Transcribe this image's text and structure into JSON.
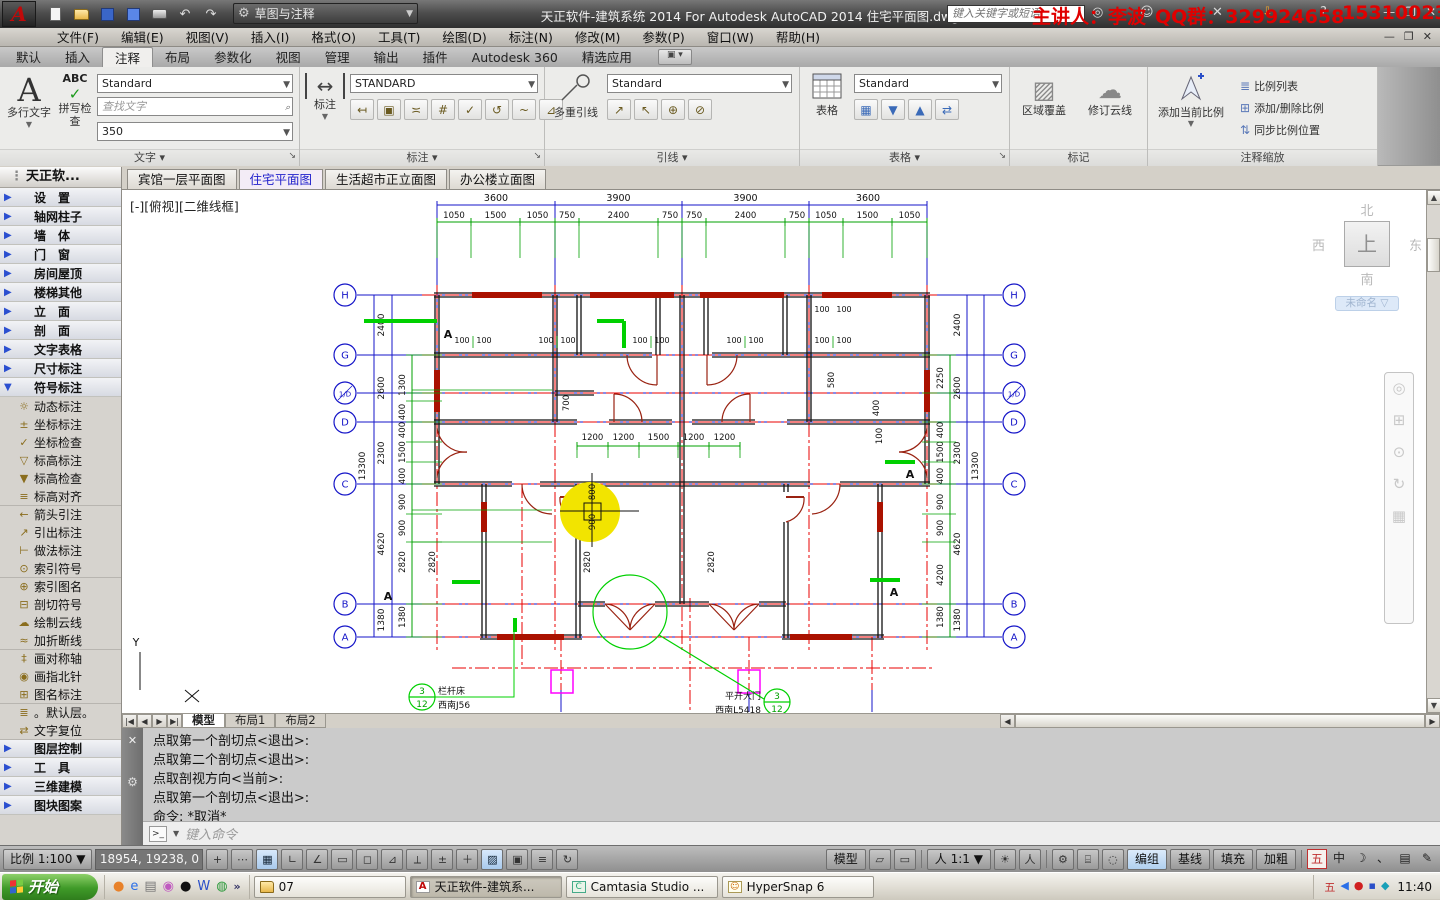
{
  "title_bar": {
    "app_title": "天正软件-建筑系统 2014  For Autodesk AutoCAD 2014   住宅平面图.dwg",
    "workspace": "草图与注释",
    "search_placeholder": "键入关键字或短语",
    "watermark": {
      "presenter": "主讲人：李波",
      "qq_group": "QQ群：329924658",
      "qq_extra": "15310023"
    }
  },
  "menu_bar": {
    "items": [
      {
        "label": "文件(F)"
      },
      {
        "label": "编辑(E)"
      },
      {
        "label": "视图(V)"
      },
      {
        "label": "插入(I)"
      },
      {
        "label": "格式(O)"
      },
      {
        "label": "工具(T)"
      },
      {
        "label": "绘图(D)"
      },
      {
        "label": "标注(N)"
      },
      {
        "label": "修改(M)"
      },
      {
        "label": "参数(P)"
      },
      {
        "label": "窗口(W)"
      },
      {
        "label": "帮助(H)"
      }
    ]
  },
  "ribbon": {
    "tabs": [
      {
        "label": "默认"
      },
      {
        "label": "插入"
      },
      {
        "label": "注释",
        "cls": "active"
      },
      {
        "label": "布局"
      },
      {
        "label": "参数化"
      },
      {
        "label": "视图"
      },
      {
        "label": "管理"
      },
      {
        "label": "输出"
      },
      {
        "label": "插件"
      },
      {
        "label": "Autodesk 360"
      },
      {
        "label": "精选应用"
      }
    ],
    "text_panel": {
      "mtext": "多行文字",
      "spell": "拼写检查",
      "spell_abc": "ABC",
      "style": "Standard",
      "find_placeholder": "查找文字",
      "text_height": "350",
      "footer": "文字"
    },
    "dim_panel": {
      "big": "标注",
      "style": "STANDARD",
      "footer": "标注",
      "icons": [
        {
          "g": "↤"
        },
        {
          "g": "▣"
        },
        {
          "g": "≍"
        },
        {
          "g": "#"
        },
        {
          "g": "✓"
        },
        {
          "g": "↺"
        },
        {
          "g": "~"
        },
        {
          "g": "⊿"
        }
      ]
    },
    "leader_panel": {
      "big": "多重引线",
      "style": "Standard",
      "footer": "引线",
      "icons": [
        {
          "g": "↗"
        },
        {
          "g": "↖"
        },
        {
          "g": "⊕"
        },
        {
          "g": "⊘"
        }
      ]
    },
    "table_panel": {
      "big": "表格",
      "style": "Standard",
      "footer": "表格",
      "icons": [
        {
          "g": "▦"
        },
        {
          "g": "▼"
        },
        {
          "g": "▲"
        },
        {
          "g": "⇄"
        }
      ]
    },
    "mark_panel": {
      "footer": "标记",
      "items": [
        {
          "label": "区域覆盖",
          "g": "▨"
        },
        {
          "label": "修订云线",
          "g": "☁"
        }
      ]
    },
    "scale_panel": {
      "big": "添加当前比例",
      "footer": "注释缩放",
      "items": [
        {
          "label": "比例列表",
          "g": "≣"
        },
        {
          "label": "添加/删除比例",
          "g": "⊞"
        },
        {
          "label": "同步比例位置",
          "g": "⇅"
        }
      ]
    }
  },
  "sidebar": {
    "title": "天正软...",
    "items": [
      {
        "cls": "group",
        "arrow": "▶",
        "label": "设　置"
      },
      {
        "cls": "group",
        "arrow": "▶",
        "label": "轴网柱子"
      },
      {
        "cls": "group",
        "arrow": "▶",
        "label": "墙　体"
      },
      {
        "cls": "group",
        "arrow": "▶",
        "label": "门　窗"
      },
      {
        "cls": "group",
        "arrow": "▶",
        "label": "房间屋顶"
      },
      {
        "cls": "group",
        "arrow": "▶",
        "label": "楼梯其他"
      },
      {
        "cls": "group",
        "arrow": "▶",
        "label": "立　面"
      },
      {
        "cls": "group",
        "arrow": "▶",
        "label": "剖　面"
      },
      {
        "cls": "group",
        "arrow": "▶",
        "label": "文字表格"
      },
      {
        "cls": "group",
        "arrow": "▶",
        "label": "尺寸标注"
      },
      {
        "cls": "group",
        "arrow": "▼",
        "label": "符号标注"
      },
      {
        "cls": "cmd",
        "icon": "☼",
        "label": "动态标注"
      },
      {
        "cls": "cmd",
        "icon": "±",
        "label": "坐标标注"
      },
      {
        "cls": "cmd",
        "icon": "✓",
        "label": "坐标检查"
      },
      {
        "cls": "cmd",
        "icon": "▽",
        "label": "标高标注"
      },
      {
        "cls": "cmd",
        "icon": "▼",
        "label": "标高检查"
      },
      {
        "cls": "cmd",
        "icon": "≡",
        "label": "标高对齐"
      },
      {
        "cls": "cmd sep",
        "icon": "←",
        "label": "箭头引注"
      },
      {
        "cls": "cmd",
        "icon": "↗",
        "label": "引出标注"
      },
      {
        "cls": "cmd",
        "icon": "⊢",
        "label": "做法标注"
      },
      {
        "cls": "cmd",
        "icon": "⊙",
        "label": "索引符号"
      },
      {
        "cls": "cmd sep",
        "icon": "⊕",
        "label": "索引图名"
      },
      {
        "cls": "cmd",
        "icon": "⊟",
        "label": "剖切符号"
      },
      {
        "cls": "cmd",
        "icon": "☁",
        "label": "绘制云线"
      },
      {
        "cls": "cmd",
        "icon": "≈",
        "label": "加折断线"
      },
      {
        "cls": "cmd sep",
        "icon": "‡",
        "label": "画对称轴"
      },
      {
        "cls": "cmd",
        "icon": "◉",
        "label": "画指北针"
      },
      {
        "cls": "cmd",
        "icon": "⊞",
        "label": "图名标注"
      },
      {
        "cls": "cmd sep",
        "icon": "≣",
        "label": "。默认层。"
      },
      {
        "cls": "cmd",
        "icon": "⇄",
        "label": "文字复位"
      },
      {
        "cls": "group sep",
        "arrow": "▶",
        "label": "图层控制"
      },
      {
        "cls": "group",
        "arrow": "▶",
        "label": "工　具"
      },
      {
        "cls": "group",
        "arrow": "▶",
        "label": "三维建模"
      },
      {
        "cls": "group",
        "arrow": "▶",
        "label": "图块图案"
      }
    ]
  },
  "doc_tabs": [
    {
      "label": "宾馆一层平面图"
    },
    {
      "label": "住宅平面图",
      "cls": "active"
    },
    {
      "label": "生活超市正立面图"
    },
    {
      "label": "办公楼立面图"
    }
  ],
  "viewport": {
    "label": "[-][俯视][二维线框]",
    "viewcube": {
      "n": "北",
      "w": "西",
      "e": "东",
      "s": "南",
      "top": "上",
      "view_name": "未命名 ▽"
    }
  },
  "drawing": {
    "axes": [
      "H",
      "G",
      "1/D",
      "D",
      "C",
      "B",
      "A"
    ],
    "top_major": [
      "3600",
      "3900",
      "3900",
      "3600"
    ],
    "top_minor": [
      "1050",
      "1500",
      "1050",
      "750",
      "2400",
      "750",
      "750",
      "2400",
      "750",
      "1050",
      "1500",
      "1050"
    ],
    "inner_row": [
      "1200",
      "1200",
      "1500",
      "1200",
      "1200"
    ],
    "pair_dim": "100",
    "left_outer": "13300",
    "right_outer": "13300",
    "left_blue": [
      "2400",
      "2600",
      "2300",
      "4620",
      "1380"
    ],
    "right_blue": [
      "2400",
      "2600",
      "2300",
      "4620",
      "1380"
    ],
    "left_green": [
      "1300",
      "400",
      "400",
      "1500",
      "400",
      "900",
      "900",
      "2820",
      "1380"
    ],
    "right_green": [
      "2250",
      "400",
      "1500",
      "400",
      "900",
      "900",
      "4200",
      "1380"
    ],
    "misc_dims": [
      "800",
      "900",
      "2820",
      "2820",
      "2820",
      "700",
      "580",
      "400",
      "100"
    ],
    "section_mark": "A",
    "index_left": {
      "top": "3",
      "bottom": "12",
      "note1": "栏杆床",
      "note2": "西南J56"
    },
    "index_right": {
      "top": "3",
      "bottom": "12",
      "note1": "平开大门",
      "note2": "西南L5418"
    },
    "ucs_axis": "Y"
  },
  "layout_tabs": [
    {
      "label": "模型",
      "cls": "active"
    },
    {
      "label": "布局1"
    },
    {
      "label": "布局2"
    }
  ],
  "command": {
    "history": [
      {
        "text": "点取第一个剖切点<退出>:"
      },
      {
        "text": "点取第二个剖切点<退出>:"
      },
      {
        "text": "点取剖视方向<当前>:"
      },
      {
        "text": "点取第一个剖切点<退出>:"
      },
      {
        "text": "命令: *取消*"
      }
    ],
    "prompt_placeholder": "键入命令"
  },
  "status_bar": {
    "scale": "比例 1:100 ▼",
    "coords": "18954, 19238, 0",
    "toggles": [
      {
        "g": "+"
      },
      {
        "g": "⋯"
      },
      {
        "g": "▦",
        "cls": "on"
      },
      {
        "g": "∟"
      },
      {
        "g": "∠"
      },
      {
        "g": "▭"
      },
      {
        "g": "◻"
      },
      {
        "g": "⊿"
      },
      {
        "g": "⟂"
      },
      {
        "g": "±"
      },
      {
        "g": "＋"
      },
      {
        "g": "▨",
        "cls": "on"
      },
      {
        "g": "▣"
      },
      {
        "g": "≡"
      },
      {
        "g": "↻"
      }
    ],
    "model": "模型",
    "anno_scale": "人 1:1 ▼",
    "text_buttons": [
      {
        "label": "编组",
        "cls": "on"
      },
      {
        "label": "基线"
      },
      {
        "label": "填充"
      },
      {
        "label": "加粗"
      }
    ],
    "ime": [
      {
        "g": "五",
        "cls": "red"
      },
      {
        "g": "中"
      },
      {
        "g": "☽"
      },
      {
        "g": "、"
      },
      {
        "g": "▤"
      },
      {
        "g": "✎"
      }
    ]
  },
  "taskbar": {
    "start": "开始",
    "quick": [
      {
        "g": "●",
        "c": "#e8822a"
      },
      {
        "g": "e",
        "c": "#2a6fe8"
      },
      {
        "g": "▤",
        "c": "#777"
      },
      {
        "g": "◉",
        "c": "#c05ac0"
      },
      {
        "g": "●",
        "c": "#111"
      },
      {
        "g": "W",
        "c": "#2a4fc8"
      },
      {
        "g": "◍",
        "c": "#2a9a3a"
      }
    ],
    "quick_more": "»",
    "windows": [
      {
        "label": "07",
        "icon": "folder"
      },
      {
        "label": "天正软件-建筑系...",
        "icon": "acad",
        "cls": "active",
        "icon_letter": "A"
      },
      {
        "label": "Camtasia Studio ...",
        "icon": "cam",
        "icon_letter": "C"
      },
      {
        "label": "HyperSnap 6",
        "icon": "hs",
        "icon_letter": "☺"
      }
    ],
    "tray": [
      {
        "g": "五",
        "c": "#c03030"
      },
      {
        "g": "◀",
        "c": "#2a6fe8"
      },
      {
        "g": "●",
        "c": "#d02020"
      },
      {
        "g": "▪",
        "c": "#2a4fc8"
      },
      {
        "g": "◆",
        "c": "#18a0b8"
      }
    ],
    "time": "11:40"
  }
}
